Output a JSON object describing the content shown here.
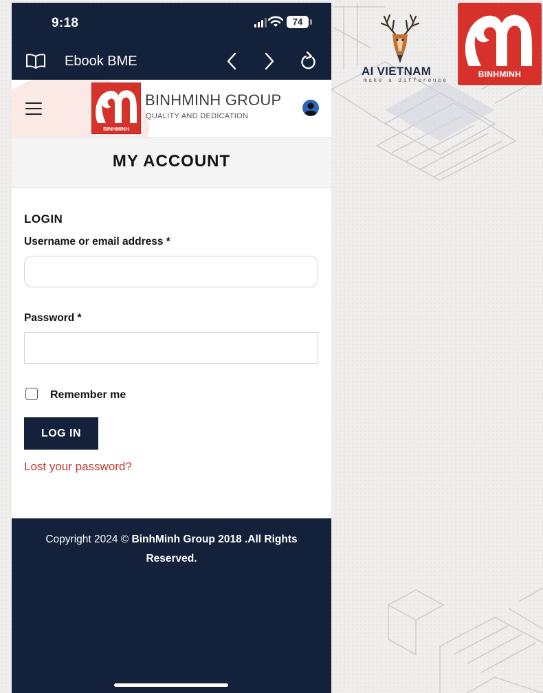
{
  "status_bar": {
    "time": "9:18",
    "battery": "74"
  },
  "browser": {
    "title": "Ebook BME"
  },
  "site": {
    "brand_name": "BINHMINH GROUP",
    "tagline": "QUALITY AND DEDICATION",
    "logo_label": "BINHMINH",
    "registered_mark": "®"
  },
  "page": {
    "title": "MY ACCOUNT"
  },
  "login": {
    "heading": "LOGIN",
    "username_label": "Username or email address *",
    "username_value": "",
    "password_label": "Password *",
    "password_value": "",
    "remember_label": "Remember me",
    "remember_checked": false,
    "submit_label": "LOG IN",
    "lost_password": "Lost your password?"
  },
  "footer": {
    "copyright_prefix": "Copyright 2024 © ",
    "copyright_strong": "BinhMinh Group 2018 .All Rights Reserved."
  },
  "slide": {
    "org_name": "AI VIETNAM",
    "org_tagline": "make a difference",
    "partner_logo_label": "BINHMINH"
  },
  "colors": {
    "navy": "#14213a",
    "brand_red": "#d5322c",
    "link_red": "#c0392b"
  },
  "icons": [
    "book-icon",
    "back-icon",
    "forward-icon",
    "reload-icon",
    "menu-icon",
    "user-icon",
    "signal-icon",
    "wifi-icon",
    "deer-icon"
  ]
}
